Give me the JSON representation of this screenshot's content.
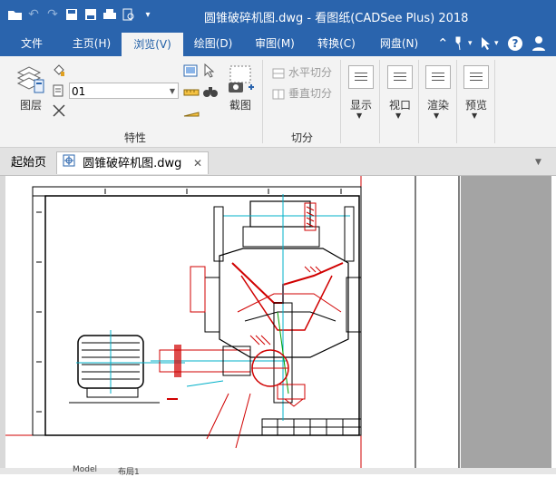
{
  "window": {
    "title": "圆锥破碎机图.dwg - 看图纸(CADSee Plus) 2018"
  },
  "quick_access": [
    {
      "name": "open-icon",
      "glyph": "📂"
    },
    {
      "name": "undo-icon",
      "glyph": "↶"
    },
    {
      "name": "redo-icon",
      "glyph": "↷"
    },
    {
      "name": "save-icon",
      "glyph": "▣"
    },
    {
      "name": "save-as-icon",
      "glyph": "▤"
    },
    {
      "name": "print-icon",
      "glyph": "⎙"
    },
    {
      "name": "print-preview-icon",
      "glyph": "🔍"
    },
    {
      "name": "customize-icon",
      "glyph": "▾"
    }
  ],
  "menu": {
    "items": [
      "文件",
      "主页(H)",
      "浏览(V)",
      "绘图(D)",
      "审图(M)",
      "转换(C)",
      "网盘(N)"
    ],
    "active": "浏览(V)"
  },
  "ribbon": {
    "layer_label": "图层",
    "layer_value": "01",
    "screenshot_label": "截图",
    "properties_group": "特性",
    "horizontal_split": "水平切分",
    "vertical_split": "垂直切分",
    "split_group": "切分",
    "display_label": "显示",
    "viewport_label": "视口",
    "render_label": "渲染",
    "preview_label": "预览"
  },
  "tabs": {
    "start": "起始页",
    "document": "圆锥破碎机图.dwg"
  },
  "layout_tabs": [
    "Model",
    "布局1"
  ],
  "colors": {
    "title_bg": "#2a64ad",
    "ribbon_bg": "#f3f3f3",
    "drawing_red": "#d00000",
    "drawing_cyan": "#00b0c8"
  }
}
